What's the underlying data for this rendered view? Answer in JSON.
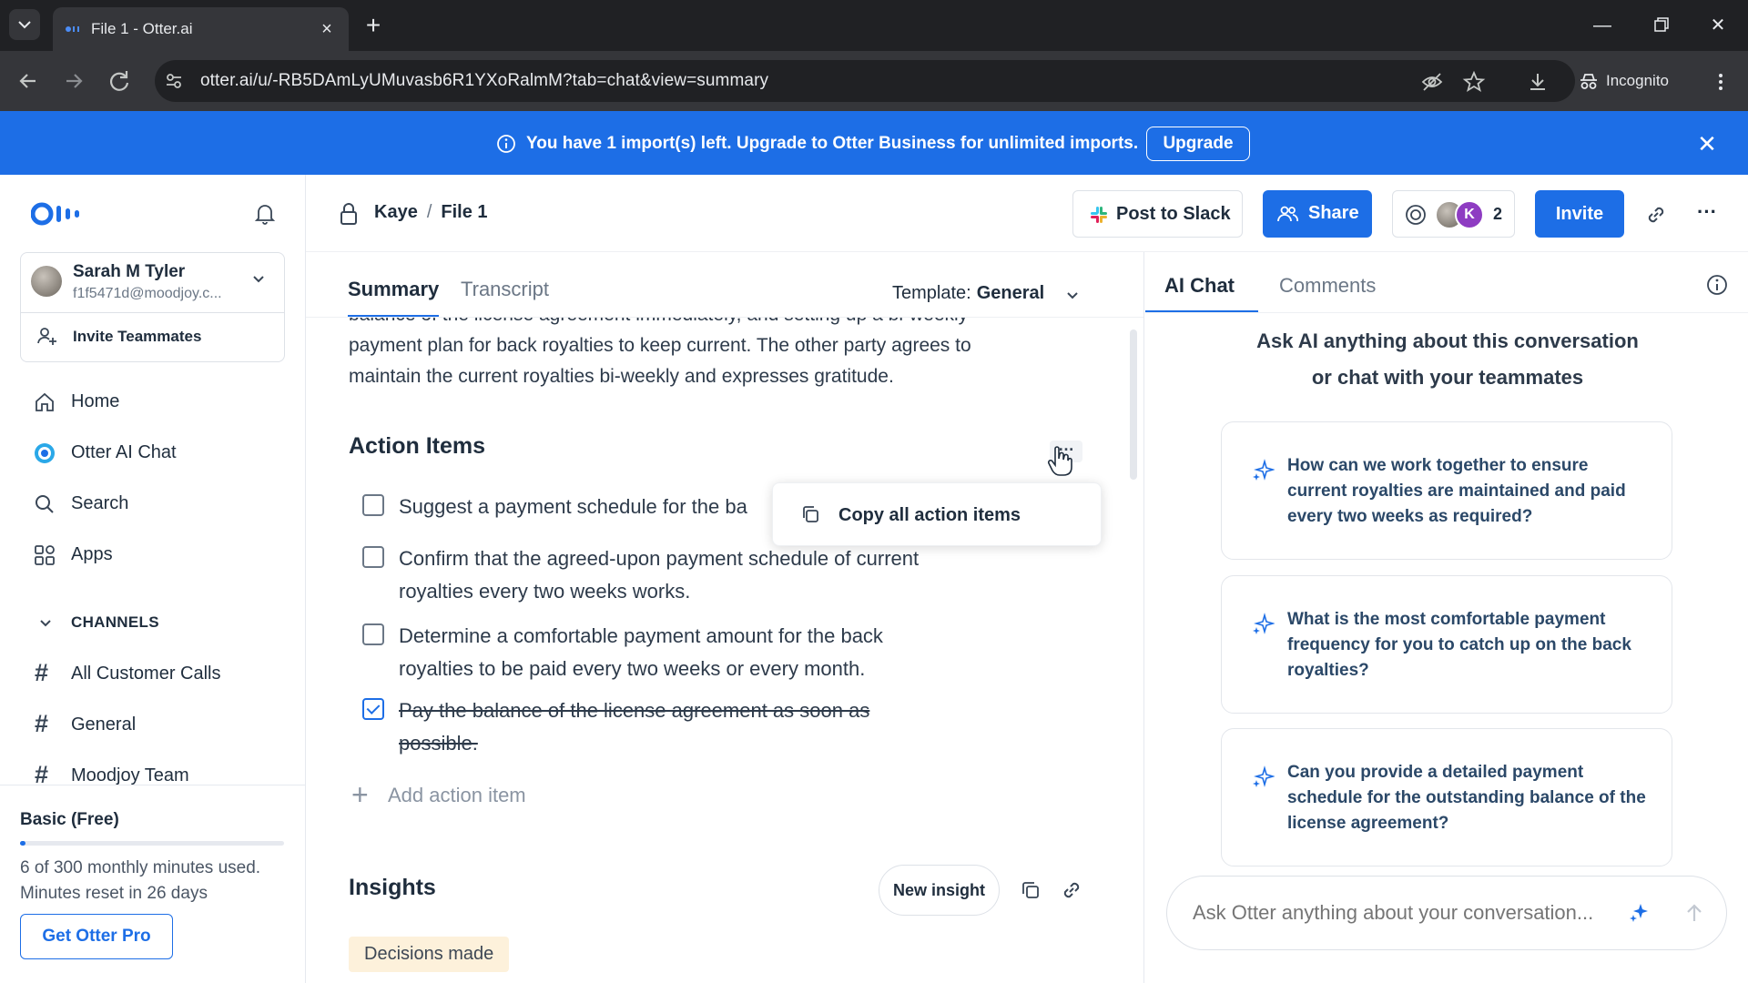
{
  "browser": {
    "tab_title": "File 1 - Otter.ai",
    "url": "otter.ai/u/-RB5DAmLyUMuvasb6R1YXoRalmM?tab=chat&view=summary",
    "incognito_label": "Incognito"
  },
  "banner": {
    "text": "You have 1 import(s) left. Upgrade to Otter Business for unlimited imports.",
    "upgrade_label": "Upgrade"
  },
  "sidebar": {
    "user_name": "Sarah M Tyler",
    "user_email": "f1f5471d@moodjoy.c...",
    "invite_label": "Invite Teammates",
    "nav": [
      {
        "label": "Home",
        "icon": "home-icon"
      },
      {
        "label": "Otter AI Chat",
        "icon": "otter-ai-chat-icon"
      },
      {
        "label": "Search",
        "icon": "search-icon"
      },
      {
        "label": "Apps",
        "icon": "apps-icon"
      }
    ],
    "channels_title": "CHANNELS",
    "channels": [
      "All Customer Calls",
      "General",
      "Moodjoy Team"
    ],
    "plan_name": "Basic (Free)",
    "plan_usage_fraction": 0.02,
    "plan_usage_line1": "6 of 300 monthly minutes used.",
    "plan_usage_line2": "Minutes reset in 26 days",
    "get_pro_label": "Get Otter Pro"
  },
  "header": {
    "crumb_owner": "Kaye",
    "crumb_sep": "/",
    "crumb_file": "File 1",
    "post_slack_label": "Post to Slack",
    "share_label": "Share",
    "collab_initial": "K",
    "collab_count": "2",
    "invite_label": "Invite"
  },
  "main": {
    "tab_summary": "Summary",
    "tab_transcript": "Transcript",
    "template_label": "Template:",
    "template_value": "General",
    "summary_partial_top": "balance of the license agreement immediately, and setting up a bi-weekly",
    "summary_line2": "payment plan for back royalties to keep current. The other party agrees to",
    "summary_line3": "maintain the current royalties bi-weekly and expresses gratitude.",
    "action_items_title": "Action Items",
    "action_more": "…",
    "dropdown_copy_label": "Copy all action items",
    "action_items": [
      {
        "text": "Suggest a payment schedule for the ba",
        "checked": false
      },
      {
        "text": "Confirm that the agreed-upon payment schedule of current royalties every two weeks works.",
        "checked": false
      },
      {
        "text": "Determine a comfortable payment amount for the back royalties to be paid every two weeks or every month.",
        "checked": false
      },
      {
        "text": "Pay the balance of the license agreement as soon as possible.",
        "checked": true
      }
    ],
    "add_action_label": "Add action item",
    "insights_title": "Insights",
    "new_insight_label": "New insight",
    "decisions_chip": "Decisions made"
  },
  "right": {
    "tab_ai_chat": "AI Chat",
    "tab_comments": "Comments",
    "intro_line1": "Ask AI anything about this conversation",
    "intro_line2": "or chat with your teammates",
    "suggestions": [
      "How can we work together to ensure current royalties are maintained and paid every two weeks as required?",
      "What is the most comfortable payment frequency for you to catch up on the back royalties?",
      "Can you provide a detailed payment schedule for the outstanding balance of the license agreement?"
    ],
    "ask_placeholder": "Ask Otter anything about your conversation..."
  },
  "colors": {
    "accent": "#1d6ee6",
    "banner_bg": "#1d6ee6",
    "chip_bg": "#fdf1db"
  }
}
